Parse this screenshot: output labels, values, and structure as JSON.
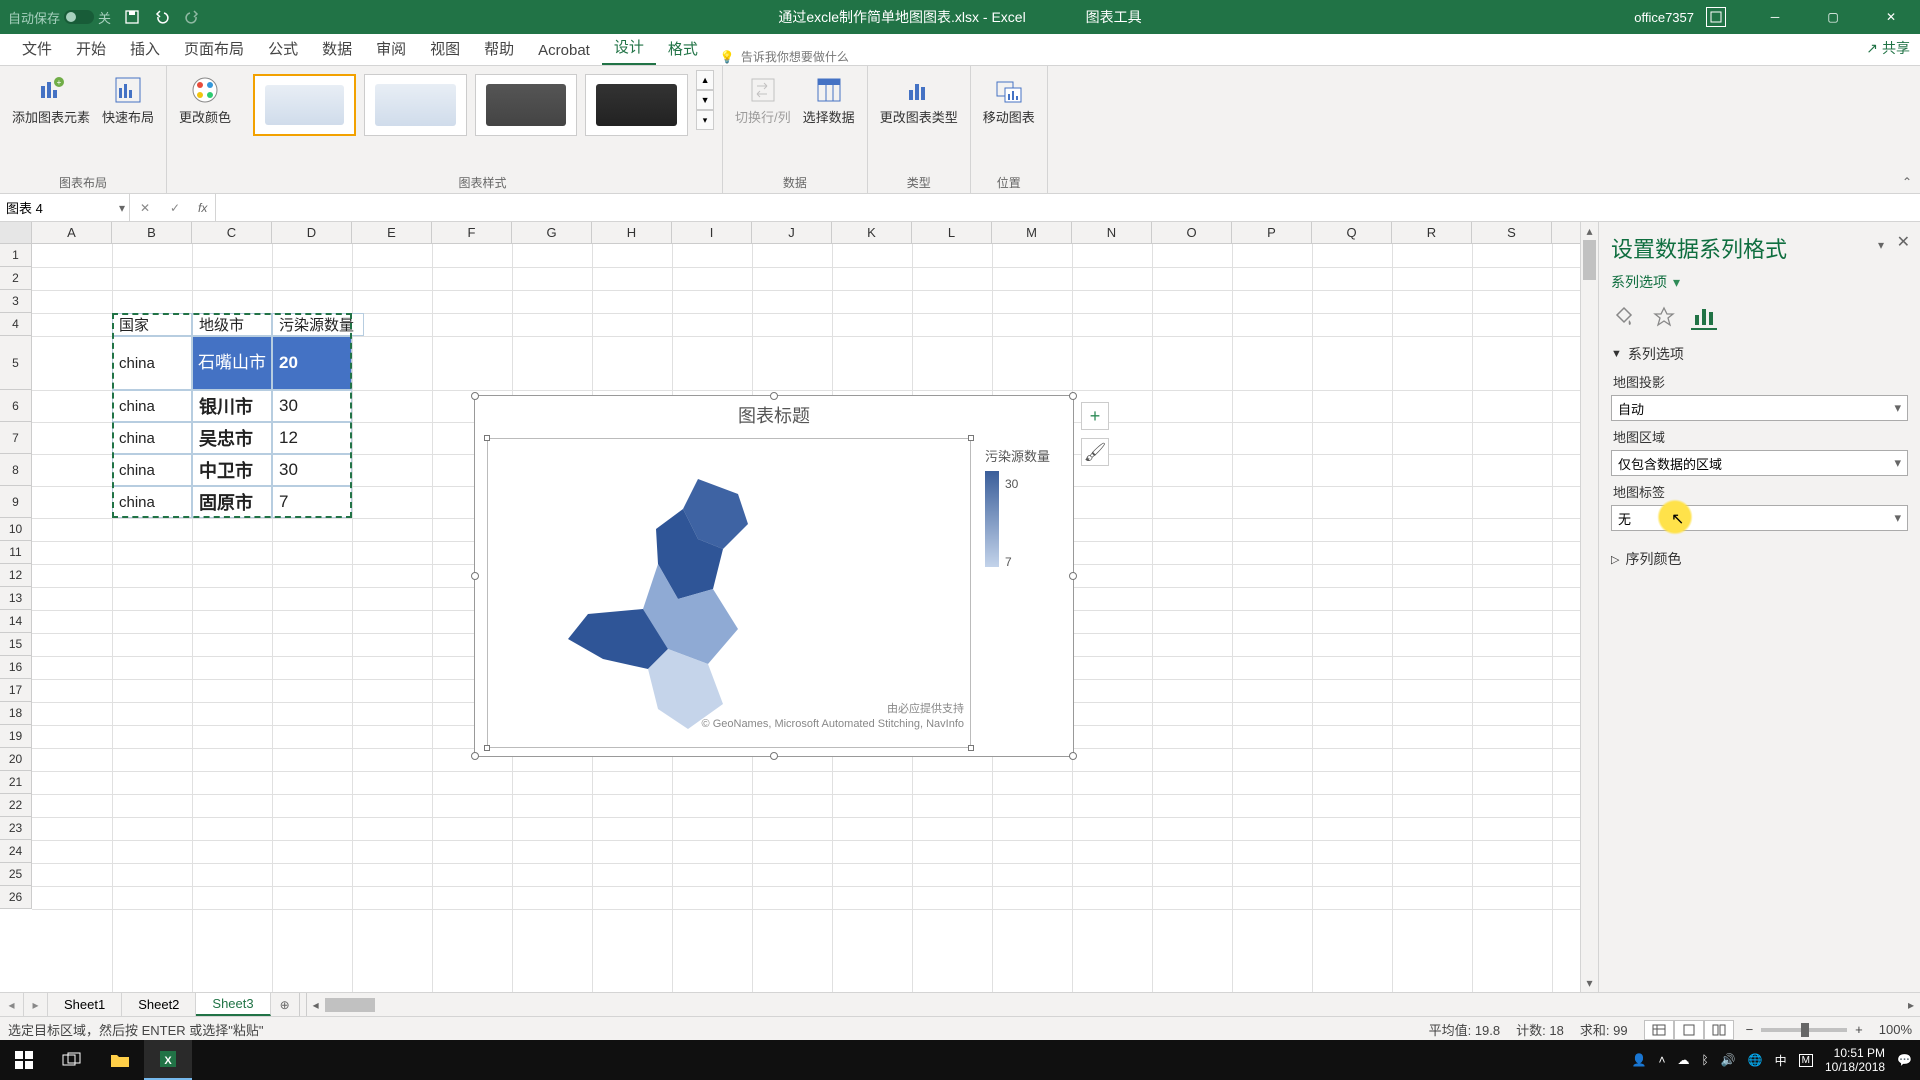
{
  "titlebar": {
    "autosave_label": "自动保存",
    "autosave_state": "关",
    "doc_title": "通过excle制作简单地图图表.xlsx - Excel",
    "chart_tools": "图表工具",
    "user": "office7357"
  },
  "tabs": {
    "file": "文件",
    "home": "开始",
    "insert": "插入",
    "layout": "页面布局",
    "formulas": "公式",
    "data": "数据",
    "review": "审阅",
    "view": "视图",
    "help": "帮助",
    "acrobat": "Acrobat",
    "design": "设计",
    "format": "格式",
    "tellme_placeholder": "告诉我你想要做什么",
    "share": "共享"
  },
  "ribbon": {
    "group_layout": "图表布局",
    "add_element": "添加图表元素",
    "quick_layout": "快速布局",
    "change_colors": "更改颜色",
    "group_styles": "图表样式",
    "switch_rc": "切换行/列",
    "select_data": "选择数据",
    "group_data": "数据",
    "change_type": "更改图表类型",
    "group_type": "类型",
    "move_chart": "移动图表",
    "group_location": "位置"
  },
  "namebox": {
    "value": "图表 4"
  },
  "columns": [
    "A",
    "B",
    "C",
    "D",
    "E",
    "F",
    "G",
    "H",
    "I",
    "J",
    "K",
    "L",
    "M",
    "N",
    "O",
    "P",
    "Q",
    "R",
    "S"
  ],
  "rows": [
    1,
    2,
    3,
    4,
    5,
    6,
    7,
    8,
    9,
    10,
    11,
    12,
    13,
    14,
    15,
    16,
    17,
    18,
    19,
    20,
    21,
    22,
    23,
    24,
    25,
    26
  ],
  "table": {
    "headers": {
      "country": "国家",
      "city": "地级市",
      "metric": "污染源数量"
    },
    "rows": [
      {
        "country": "china",
        "city": "石嘴山市",
        "value": "20"
      },
      {
        "country": "china",
        "city": "银川市",
        "value": "30"
      },
      {
        "country": "china",
        "city": "吴忠市",
        "value": "12"
      },
      {
        "country": "china",
        "city": "中卫市",
        "value": "30"
      },
      {
        "country": "china",
        "city": "固原市",
        "value": "7"
      }
    ]
  },
  "chart": {
    "title": "图表标题",
    "legend_title": "污染源数量",
    "legend_max": "30",
    "legend_min": "7",
    "attrib1": "由必应提供支持",
    "attrib2": "© GeoNames, Microsoft Automated Stitching, NavInfo"
  },
  "chart_data": {
    "type": "map",
    "title": "图表标题",
    "legend_label": "污染源数量",
    "scale": {
      "min": 7,
      "max": 30
    },
    "regions": [
      {
        "name": "石嘴山市",
        "value": 20
      },
      {
        "name": "银川市",
        "value": 30
      },
      {
        "name": "吴忠市",
        "value": 12
      },
      {
        "name": "中卫市",
        "value": 30
      },
      {
        "name": "固原市",
        "value": 7
      }
    ]
  },
  "pane": {
    "title": "设置数据系列格式",
    "series_options": "系列选项",
    "accordion_series": "系列选项",
    "map_projection": "地图投影",
    "map_projection_val": "自动",
    "map_area": "地图区域",
    "map_area_val": "仅包含数据的区域",
    "map_labels": "地图标签",
    "map_labels_val": "无",
    "series_color": "序列颜色"
  },
  "sheets": {
    "s1": "Sheet1",
    "s2": "Sheet2",
    "s3": "Sheet3"
  },
  "status": {
    "msg": "选定目标区域，然后按 ENTER 或选择\"粘贴\"",
    "avg_label": "平均值:",
    "avg": "19.8",
    "count_label": "计数:",
    "count": "18",
    "sum_label": "求和:",
    "sum": "99",
    "zoom": "100%"
  },
  "taskbar": {
    "time": "10:51 PM",
    "date": "10/18/2018"
  }
}
